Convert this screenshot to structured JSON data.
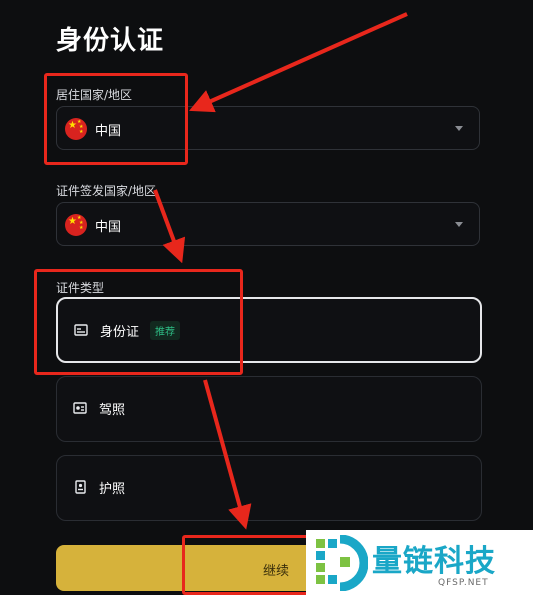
{
  "page": {
    "title": "身份认证"
  },
  "residence": {
    "label": "居住国家/地区",
    "value": "中国"
  },
  "issuing": {
    "label": "证件签发国家/地区",
    "value": "中国"
  },
  "doc_type": {
    "label": "证件类型",
    "options": [
      {
        "label": "身份证",
        "badge": "推荐",
        "icon": "id-card-icon",
        "selected": true
      },
      {
        "label": "驾照",
        "icon": "drivers-license-icon",
        "selected": false
      },
      {
        "label": "护照",
        "icon": "passport-icon",
        "selected": false
      }
    ]
  },
  "actions": {
    "continue_label": "继续"
  },
  "watermark": {
    "brand": "量链科技",
    "domain": "QFSP.NET"
  },
  "colors": {
    "accent": "#d6b23b",
    "annotation": "#e8271c",
    "badge": "#2ebd85"
  }
}
